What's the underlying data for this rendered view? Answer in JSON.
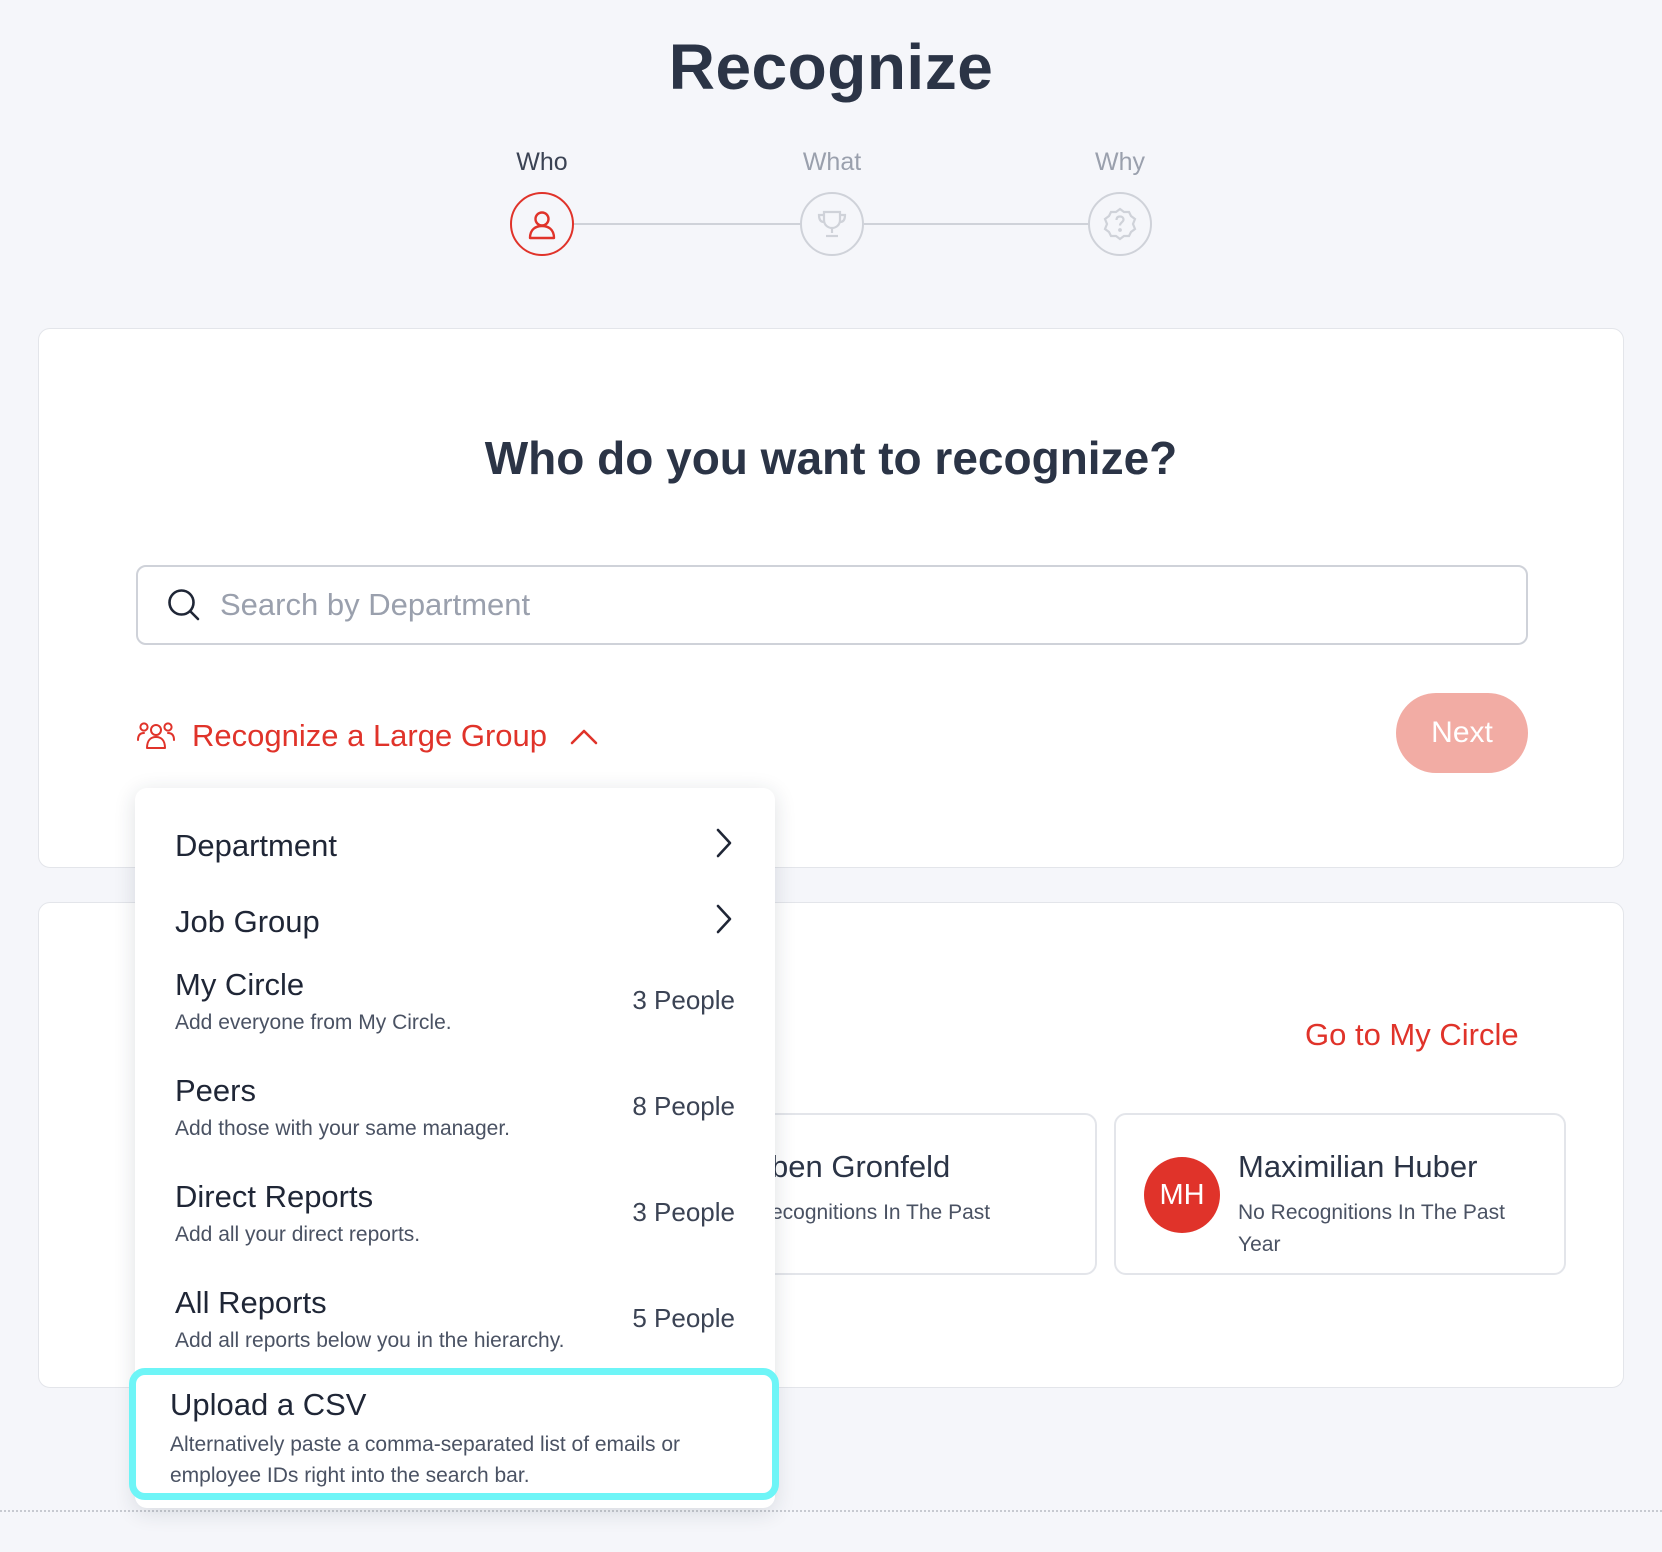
{
  "page": {
    "title": "Recognize"
  },
  "stepper": {
    "steps": [
      {
        "label": "Who",
        "icon": "person-icon",
        "active": true
      },
      {
        "label": "What",
        "icon": "trophy-icon",
        "active": false
      },
      {
        "label": "Why",
        "icon": "question-badge-icon",
        "active": false
      }
    ]
  },
  "card": {
    "question": "Who do you want to recognize?",
    "search": {
      "placeholder": "Search by Department",
      "value": ""
    },
    "large_group_label": "Recognize a Large Group",
    "next_label": "Next"
  },
  "dropdown": {
    "items": [
      {
        "title": "Department",
        "has_submenu": true
      },
      {
        "title": "Job Group",
        "has_submenu": true
      },
      {
        "title": "My Circle",
        "description": "Add everyone from My Circle.",
        "count": "3 People"
      },
      {
        "title": "Peers",
        "description": "Add those with your same manager.",
        "count": "8 People"
      },
      {
        "title": "Direct Reports",
        "description": "Add all your direct reports.",
        "count": "3 People"
      },
      {
        "title": "All Reports",
        "description": "Add all reports below you in the hierarchy.",
        "count": "5 People"
      },
      {
        "title": "Upload a CSV",
        "description_line1": "Alternatively paste a comma-separated list of emails or",
        "description_line2": "employee IDs right into the search bar."
      }
    ]
  },
  "circle": {
    "go_label": "Go to My Circle",
    "people": [
      {
        "name_partial": "ben Gronfeld",
        "sub_partial": "ecognitions In The Past"
      },
      {
        "initials": "MH",
        "name": "Maximilian Huber",
        "sub_line1": "No Recognitions In The Past",
        "sub_line2": "Year"
      }
    ]
  },
  "colors": {
    "accent": "#e0332a",
    "next_disabled": "#f2aca4",
    "highlight": "#6ef5f7",
    "text_dark": "#2b3446",
    "background": "#f5f6fa"
  }
}
